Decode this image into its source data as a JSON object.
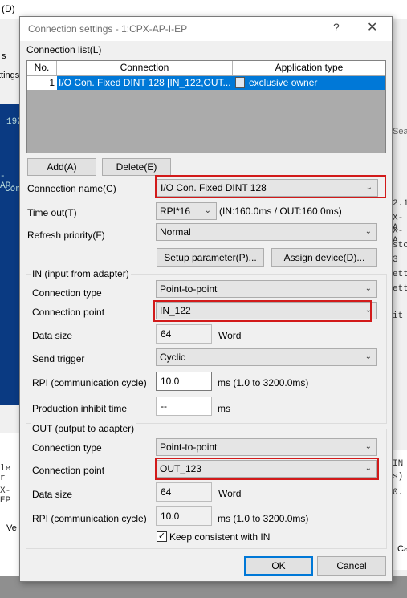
{
  "background": {
    "title_fragment": "(D)",
    "left_fragments": [
      "s",
      "ttings",
      "192",
      "-AP-",
      "Con"
    ],
    "right_fragments": [
      "Sea",
      "2.1",
      "X-A",
      "X-A",
      "stc",
      "3",
      "ett",
      "ett",
      "it",
      "IN",
      "s)",
      "0."
    ],
    "bottom_left": [
      "le r",
      "X-EP",
      "Ve"
    ],
    "bottom_right": "Ca"
  },
  "dialog": {
    "title": "Connection settings  - 1:CPX-AP-I-EP",
    "help_label": "?",
    "close_label": "✕",
    "connection_list_label": "Connection list(L)",
    "list": {
      "headers": [
        "No.",
        "Connection",
        "Application type"
      ],
      "rows": [
        {
          "no": "1",
          "connection": "I/O Con. Fixed DINT 128 [IN_122,OUT...",
          "app_type": "exclusive owner"
        }
      ]
    },
    "add_button": "Add(A)",
    "delete_button": "Delete(E)",
    "connection_name_label": "Connection name(C)",
    "connection_name_value": "I/O Con. Fixed DINT 128",
    "timeout_label": "Time out(T)",
    "timeout_value": "RPI*16",
    "timeout_info": "(IN:160.0ms / OUT:160.0ms)",
    "refresh_priority_label": "Refresh priority(F)",
    "refresh_priority_value": "Normal",
    "setup_parameter_button": "Setup parameter(P)...",
    "assign_device_button": "Assign device(D)...",
    "in_group": {
      "title": "IN (input from adapter)",
      "connection_type_label": "Connection type",
      "connection_type_value": "Point-to-point",
      "connection_point_label": "Connection point",
      "connection_point_value": "IN_122",
      "data_size_label": "Data size",
      "data_size_value": "64",
      "data_size_unit": "Word",
      "send_trigger_label": "Send trigger",
      "send_trigger_value": "Cyclic",
      "rpi_label": "RPI (communication cycle)",
      "rpi_value": "10.0",
      "rpi_unit": "ms   (1.0 to 3200.0ms)",
      "pit_label": "Production inhibit time",
      "pit_value": "--",
      "pit_unit": "ms"
    },
    "out_group": {
      "title": "OUT (output to adapter)",
      "connection_type_label": "Connection type",
      "connection_type_value": "Point-to-point",
      "connection_point_label": "Connection point",
      "connection_point_value": "OUT_123",
      "data_size_label": "Data size",
      "data_size_value": "64",
      "data_size_unit": "Word",
      "rpi_label": "RPI (communication cycle)",
      "rpi_value": "10.0",
      "rpi_unit": "ms   (1.0 to 3200.0ms)",
      "keep_consistent_label": "Keep consistent with IN",
      "keep_consistent_checked": true
    },
    "ok_button": "OK",
    "cancel_button": "Cancel"
  },
  "colors": {
    "selection": "#0078d7",
    "highlight_box": "#d21a1a",
    "background_blue": "#0a3a82"
  }
}
